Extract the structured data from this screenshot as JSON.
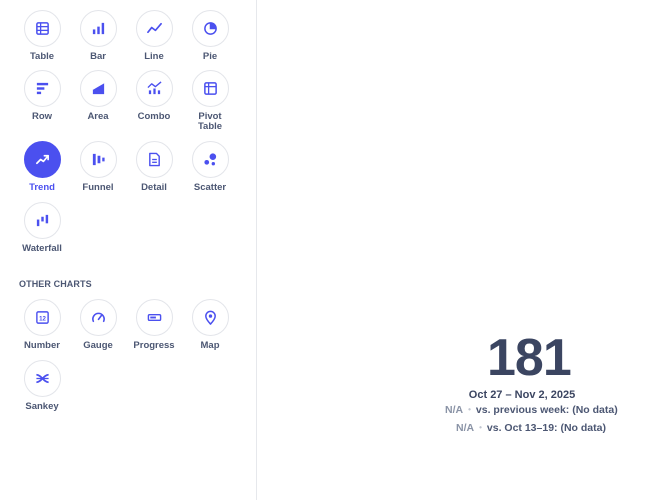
{
  "visualizations": {
    "standard": [
      {
        "label": "Table",
        "icon": "table-icon",
        "active": false
      },
      {
        "label": "Bar",
        "icon": "bar-chart-icon",
        "active": false
      },
      {
        "label": "Line",
        "icon": "line-chart-icon",
        "active": false
      },
      {
        "label": "Pie",
        "icon": "pie-chart-icon",
        "active": false
      },
      {
        "label": "Row",
        "icon": "row-chart-icon",
        "active": false
      },
      {
        "label": "Area",
        "icon": "area-chart-icon",
        "active": false
      },
      {
        "label": "Combo",
        "icon": "combo-chart-icon",
        "active": false
      },
      {
        "label": "Pivot\nTable",
        "icon": "pivot-table-icon",
        "active": false
      },
      {
        "label": "Trend",
        "icon": "trend-icon",
        "active": true
      },
      {
        "label": "Funnel",
        "icon": "funnel-icon",
        "active": false
      },
      {
        "label": "Detail",
        "icon": "detail-icon",
        "active": false
      },
      {
        "label": "Scatter",
        "icon": "scatter-icon",
        "active": false
      },
      {
        "label": "Waterfall",
        "icon": "waterfall-icon",
        "active": false
      }
    ],
    "other_title": "OTHER CHARTS",
    "other": [
      {
        "label": "Number",
        "icon": "number-icon"
      },
      {
        "label": "Gauge",
        "icon": "gauge-icon"
      },
      {
        "label": "Progress",
        "icon": "progress-icon"
      },
      {
        "label": "Map",
        "icon": "map-pin-icon"
      },
      {
        "label": "Sankey",
        "icon": "sankey-icon"
      }
    ]
  },
  "trend": {
    "value": "181",
    "date_range": "Oct 27 – Nov 2, 2025",
    "comparisons": [
      {
        "value": "N/A",
        "text": "vs. previous week: (No data)"
      },
      {
        "value": "N/A",
        "text": "vs. Oct 13–19: (No data)"
      }
    ]
  },
  "colors": {
    "accent": "#4b50ef",
    "text": "#4c5773",
    "muted": "#8a93a6",
    "border": "#e3e5ea"
  }
}
